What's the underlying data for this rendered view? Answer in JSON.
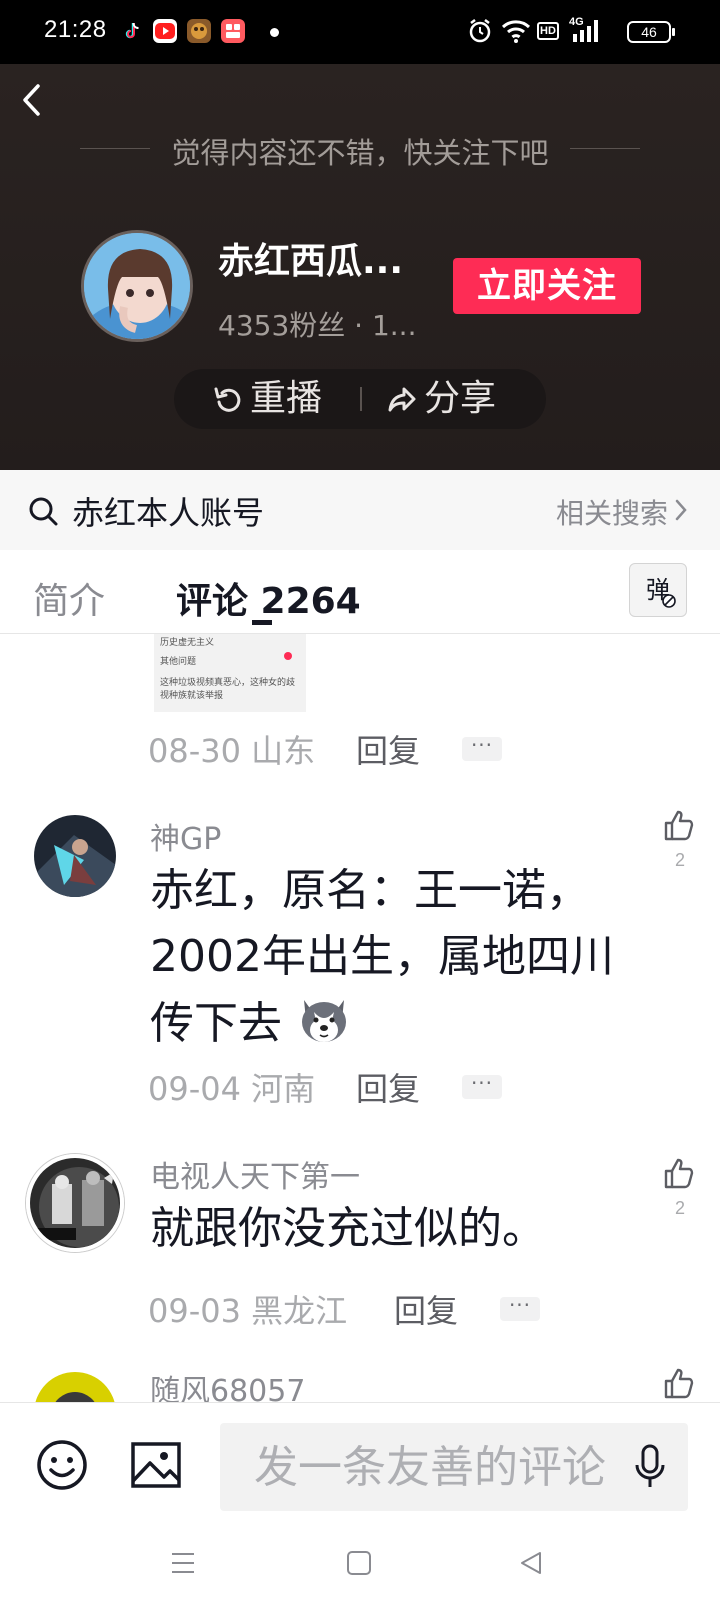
{
  "status_bar": {
    "time": "21:28",
    "battery": "46",
    "network": "4G",
    "hd": "HD",
    "icons": [
      "tiktok-icon",
      "youtube-icon",
      "game-icon",
      "app-icon",
      "dot-icon",
      "alarm-icon",
      "wifi-icon",
      "hd-icon",
      "signal-icon",
      "battery-icon"
    ]
  },
  "hero": {
    "hint": "觉得内容还不错，快关注下吧",
    "username": "赤红西瓜...",
    "stats": "4353粉丝 · 1...",
    "follow_label": "立即关注",
    "replay_label": "重播",
    "share_label": "分享"
  },
  "search": {
    "query": "赤红本人账号",
    "related": "相关搜索"
  },
  "tabs": {
    "intro": "简介",
    "comments": "评论 2264",
    "danmu": "弹"
  },
  "comments": [
    {
      "thumbnail_lines": [
        "历史虚无主义",
        "其他问题",
        "这种垃圾视频真恶心，这种女的歧",
        "视种族就该举报"
      ],
      "date": "08-30",
      "location": "山东",
      "reply": "回复",
      "more": "···"
    },
    {
      "name": "神GP",
      "text_lines": [
        "赤红，原名：王一诺，",
        "2002年出生，属地四川",
        "传下去"
      ],
      "emoji": "dog-emoji",
      "date": "09-04",
      "location": "河南",
      "reply": "回复",
      "more": "···",
      "likes": "2"
    },
    {
      "name": "电视人天下第一",
      "text_lines": [
        "就跟你没充过似的。"
      ],
      "date": "09-03",
      "location": "黑龙江",
      "reply": "回复",
      "more": "···",
      "likes": "2"
    },
    {
      "name": "随风68057"
    }
  ],
  "composer": {
    "placeholder": "发一条友善的评论"
  },
  "colors": {
    "accent": "#fe2c55",
    "hero_bg": "#2a2321",
    "text_primary": "#161823",
    "text_secondary": "#8a8b91"
  }
}
